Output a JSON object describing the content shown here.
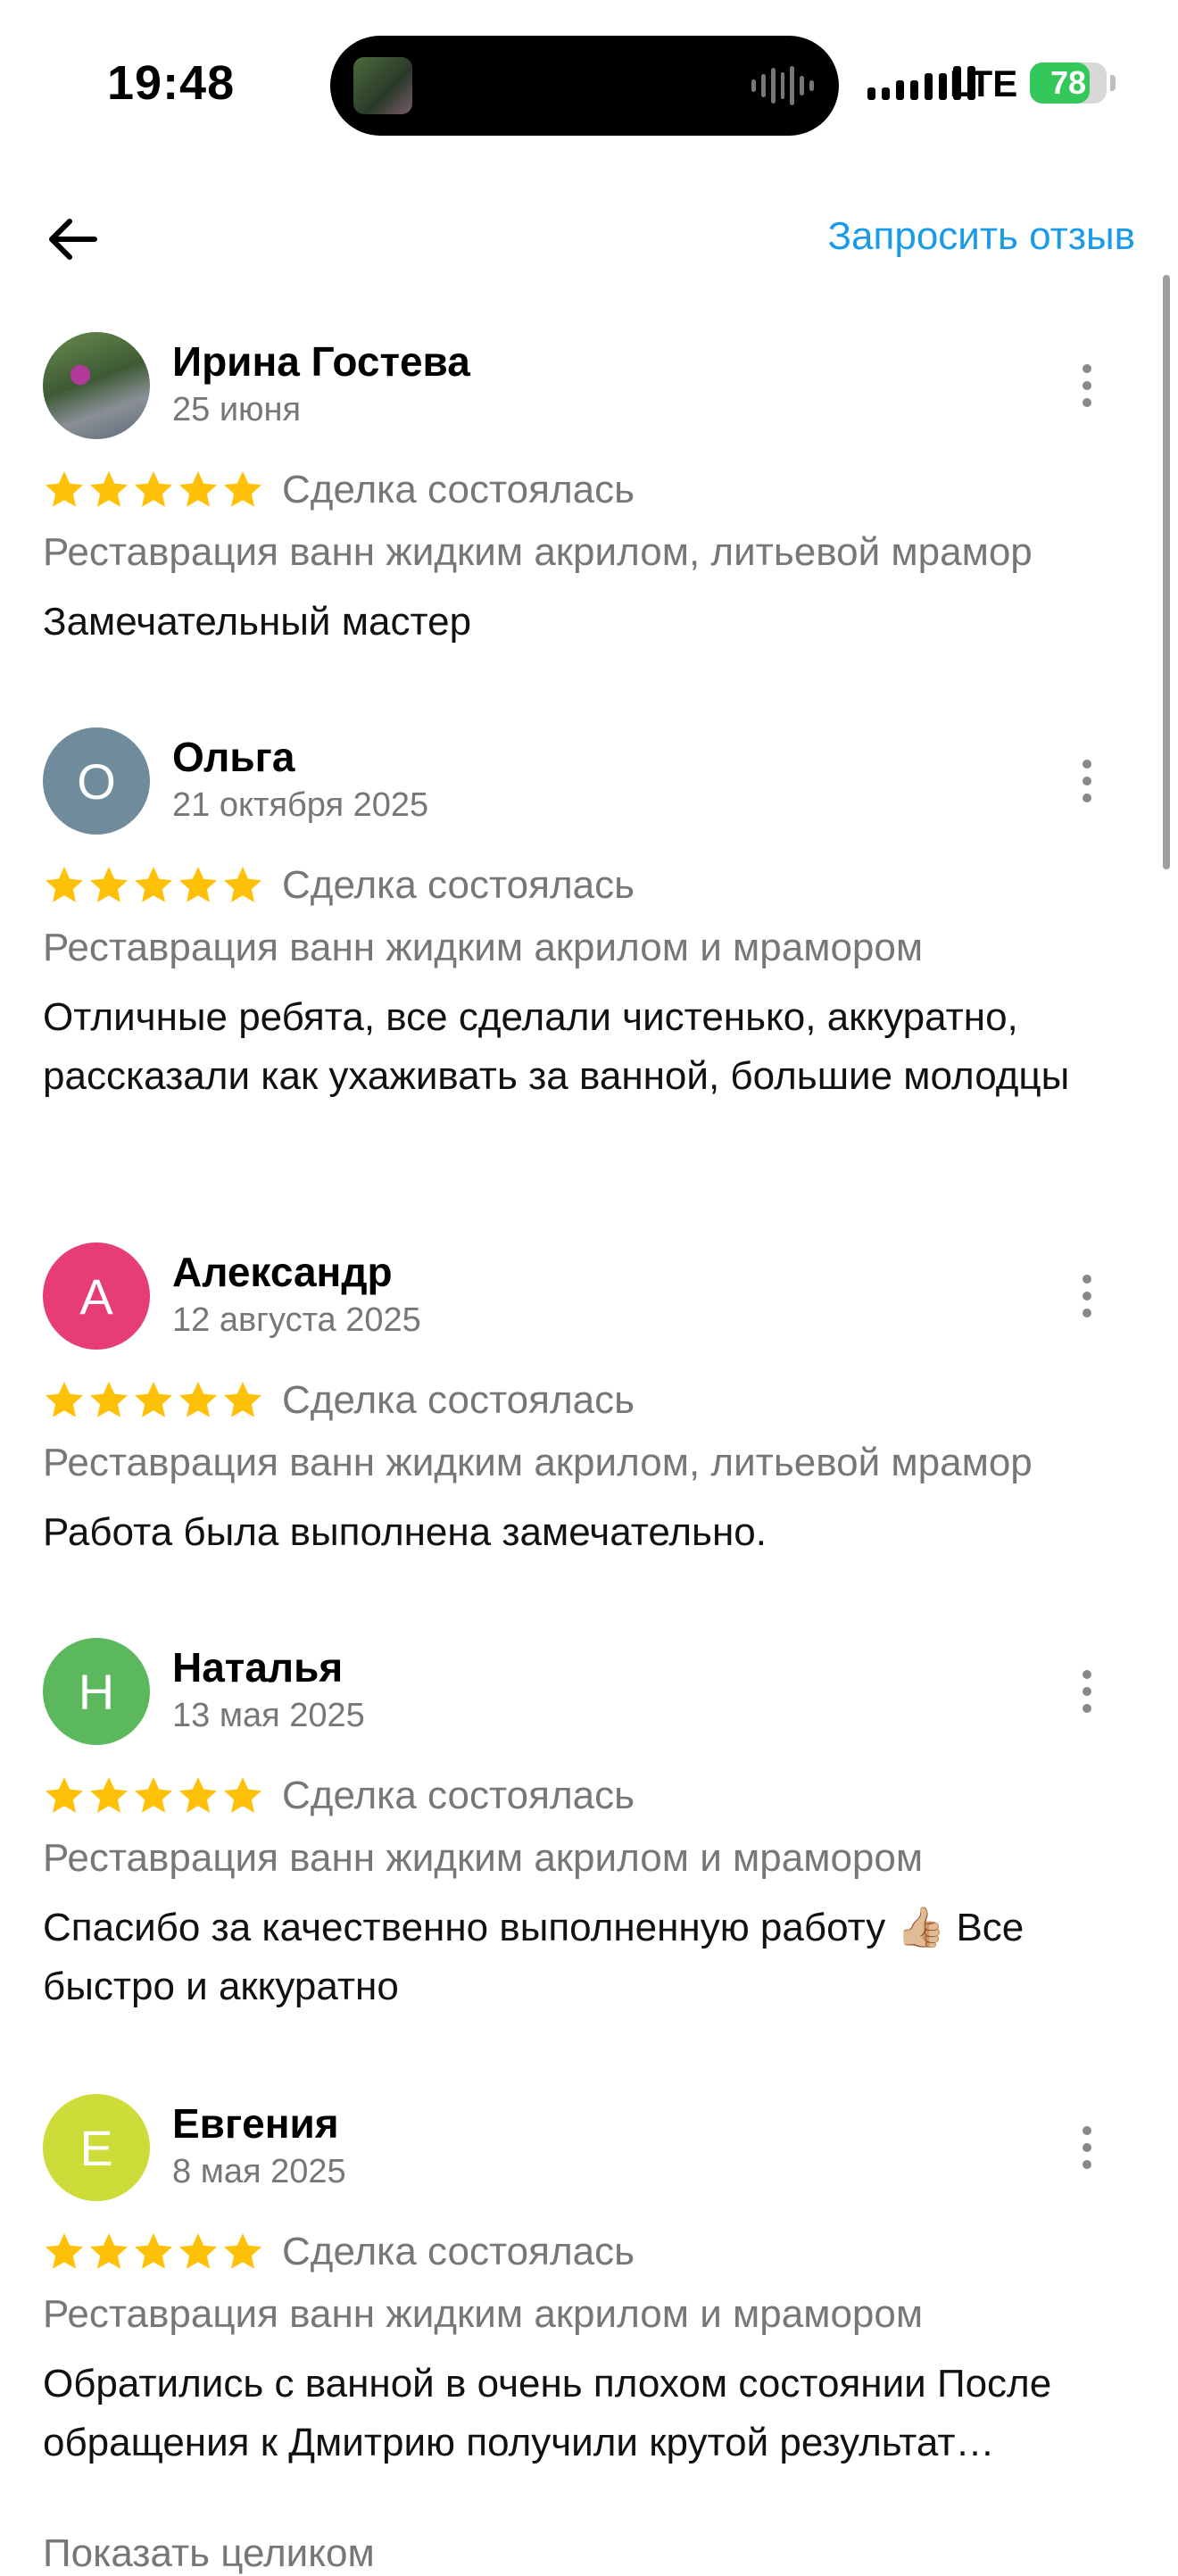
{
  "status": {
    "time": "19:48",
    "network": "LTE",
    "battery": "78",
    "battery_level": 0.78
  },
  "nav": {
    "request_review": "Запросить отзыв"
  },
  "reviews": [
    {
      "author": "Ирина Гостева",
      "date": "25 июня",
      "avatar": {
        "type": "photo",
        "letter": "",
        "color": "#6b8c4e"
      },
      "rating": 5,
      "deal": "Сделка состоялась",
      "service": "Реставрация ванн жидким акрилом, литьевой мрамор",
      "text": "Замечательный мастер"
    },
    {
      "author": "Ольга",
      "date": "21 октября 2025",
      "avatar": {
        "type": "letter",
        "letter": "О",
        "color": "#708c9c"
      },
      "rating": 5,
      "deal": "Сделка состоялась",
      "service": "Реставрация ванн жидким акрилом и мрамором",
      "text": "Отличные ребята, все сделали чистенько, аккуратно, рассказали как ухаживать за ванной, большие молодцы"
    },
    {
      "author": "Александр",
      "date": "12 августа 2025",
      "avatar": {
        "type": "letter",
        "letter": "А",
        "color": "#e63c78"
      },
      "rating": 5,
      "deal": "Сделка состоялась",
      "service": "Реставрация ванн жидким акрилом, литьевой мрамор",
      "text": "Работа была выполнена замечательно."
    },
    {
      "author": "Наталья",
      "date": "13 мая 2025",
      "avatar": {
        "type": "letter",
        "letter": "Н",
        "color": "#5cb85c"
      },
      "rating": 5,
      "deal": "Сделка состоялась",
      "service": "Реставрация ванн жидким акрилом и мрамором",
      "text": "Спасибо за качественно выполненную работу 👍🏼 Все быстро и аккуратно"
    },
    {
      "author": "Евгения",
      "date": "8 мая 2025",
      "avatar": {
        "type": "letter",
        "letter": "Е",
        "color": "#cddc39"
      },
      "rating": 5,
      "deal": "Сделка состоялась",
      "service": "Реставрация ванн жидким акрилом и мрамором",
      "text": "Обратились с ванной в очень плохом состоянии После обращения к Дмитрию получили крутой результат…",
      "show_more": "Показать целиком"
    }
  ],
  "colors": {
    "accent": "#1a9bea",
    "star": "#ffc107",
    "muted": "#777777",
    "battery": "#34c759"
  }
}
